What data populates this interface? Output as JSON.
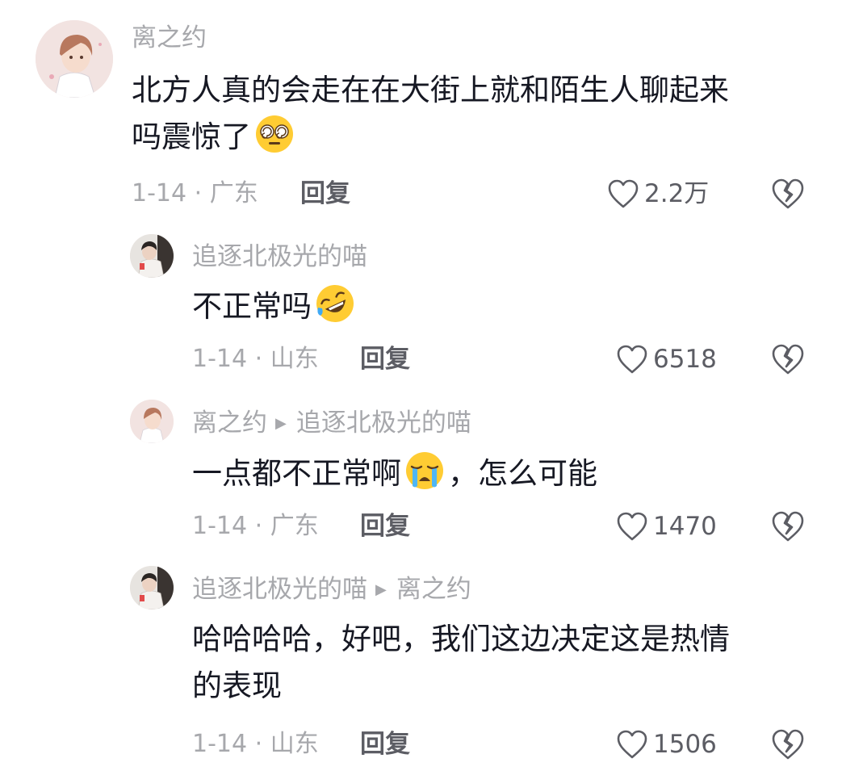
{
  "colors": {
    "username": "#a7a8ac",
    "text": "#161823",
    "meta": "#a7a8ac",
    "action": "#5c5d64"
  },
  "comments": [
    {
      "username": "离之约",
      "text_line1": "北方人真的会走在在大街上就和陌生人聊起来",
      "text_line2": "吗震惊了",
      "emoji": "dizzy-eyes-emoji",
      "date_location": "1-14 · 广东",
      "reply_label": "回复",
      "likes": "2.2万"
    },
    {
      "username": "追逐北极光的喵",
      "text": "不正常吗",
      "emoji": "rofl-emoji",
      "date_location": "1-14 · 山东",
      "reply_label": "回复",
      "likes": "6518"
    },
    {
      "username": "离之约",
      "reply_to": "追逐北极光的喵",
      "text_before": "一点都不正常啊",
      "emoji": "crying-emoji",
      "text_after": "，怎么可能",
      "date_location": "1-14 · 广东",
      "reply_label": "回复",
      "likes": "1470"
    },
    {
      "username": "追逐北极光的喵",
      "reply_to": "离之约",
      "text_line1": "哈哈哈哈，好吧，我们这边决定这是热情",
      "text_line2": "的表现",
      "date_location": "1-14 · 山东",
      "reply_label": "回复",
      "likes": "1506"
    }
  ]
}
